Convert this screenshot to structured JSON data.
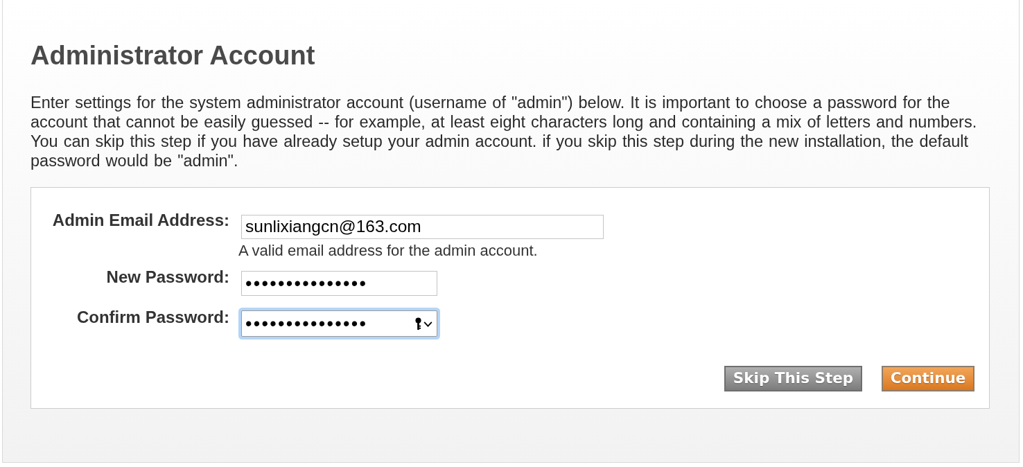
{
  "heading": "Administrator Account",
  "intro": "Enter settings for the system administrator account (username of \"admin\") below. It is important to choose a password for the account that cannot be easily guessed -- for example, at least eight characters long and containing a mix of letters and numbers. You can skip this step if you have already setup your admin account. if you skip this step during the new installation, the default password would be \"admin\".",
  "fields": [
    {
      "kind": "email",
      "label": "Admin Email Address:",
      "value": "sunlixiangcn@163.com",
      "hint": "A valid email address for the admin account.",
      "focused": false
    },
    {
      "kind": "password",
      "label": "New Password:",
      "value": "•••••••••••••••",
      "focused": false
    },
    {
      "kind": "password",
      "label": "Confirm Password:",
      "value": "•••••••••••••••",
      "focused": true
    }
  ],
  "buttons": [
    {
      "kind": "secondary",
      "label": "Skip This Step"
    },
    {
      "kind": "primary",
      "label": "Continue"
    }
  ]
}
